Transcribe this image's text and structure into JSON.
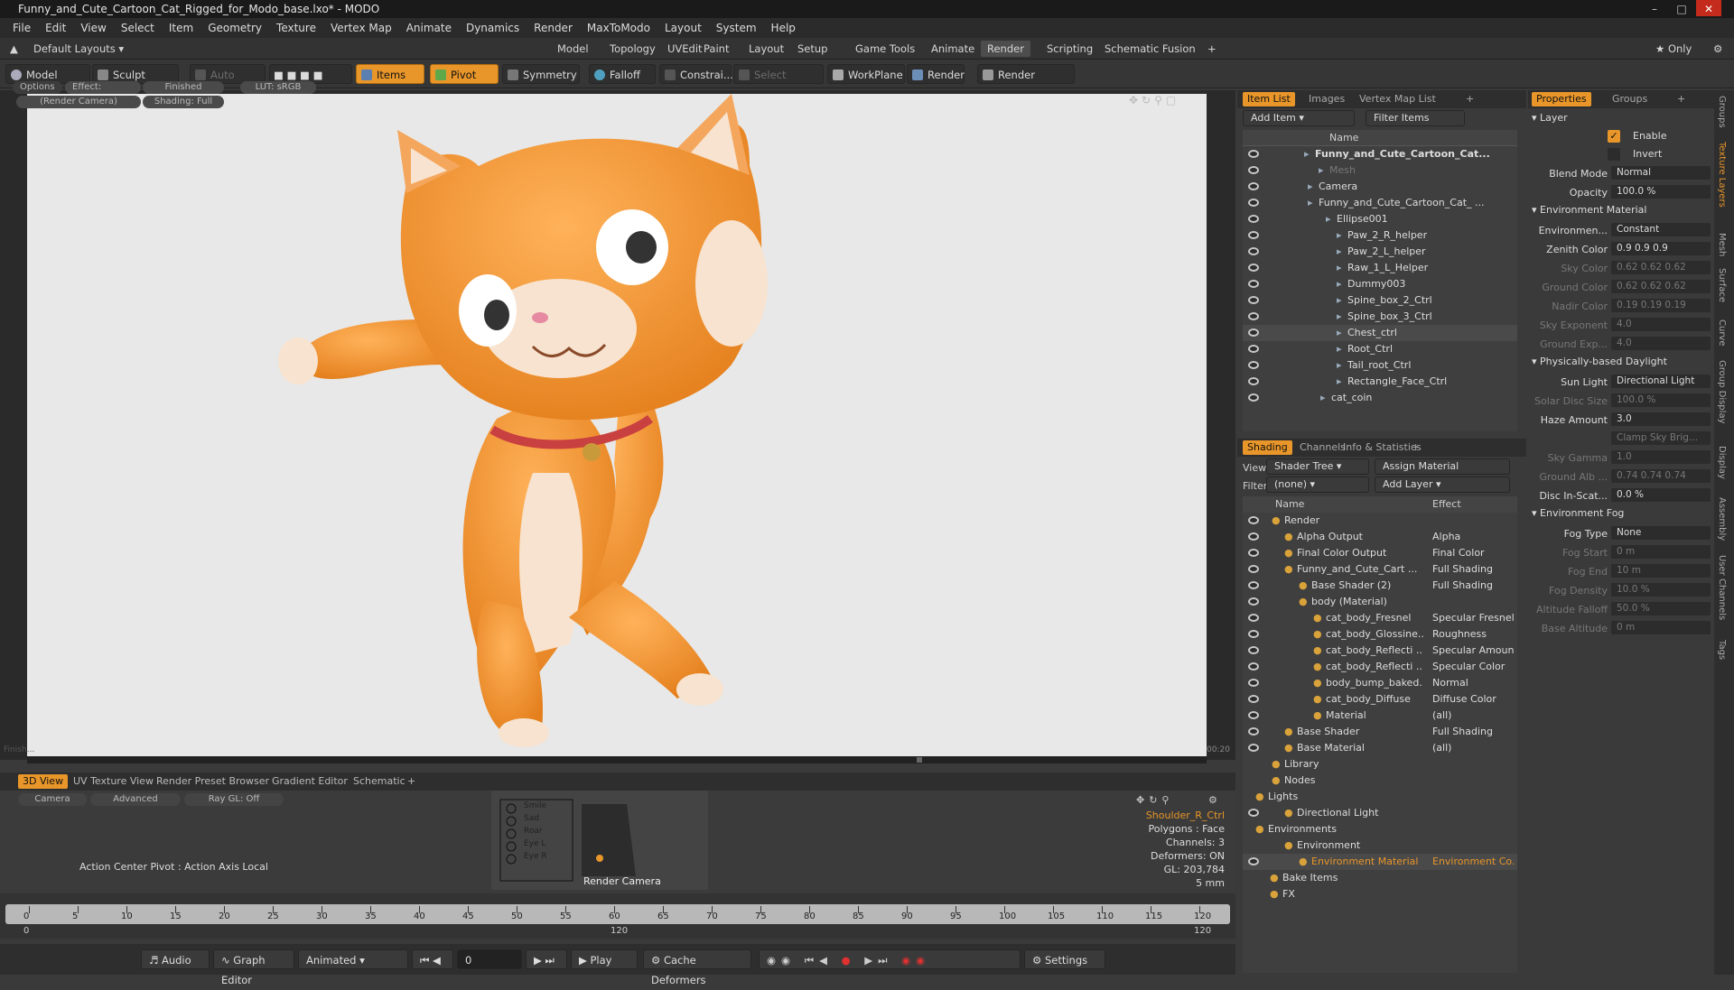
{
  "window": {
    "title": "Funny_and_Cute_Cartoon_Cat_Rigged_for_Modo_base.lxo* - MODO"
  },
  "menu": [
    "File",
    "Edit",
    "View",
    "Select",
    "Item",
    "Geometry",
    "Texture",
    "Vertex Map",
    "Animate",
    "Dynamics",
    "Render",
    "MaxToModo",
    "Layout",
    "System",
    "Help"
  ],
  "layoutbar": {
    "layout": "Default Layouts",
    "tabs": [
      "Model",
      "Topology",
      "UVEdit",
      "Paint",
      "Layout",
      "Setup",
      "Game Tools",
      "Animate",
      "Render",
      "Scripting",
      "Schematic Fusion",
      "+"
    ],
    "only": "Only"
  },
  "toolbar": {
    "model": "Model",
    "sculpt": "Sculpt",
    "auto_select": "Auto Select",
    "items": "Items",
    "pivot": "Pivot",
    "symmetry": "Symmetry",
    "falloff": "Falloff",
    "constrain": "Constrai...",
    "select_through": "Select Through",
    "workplane": "WorkPlane",
    "render": "Render",
    "render_window": "Render Window"
  },
  "viewport": {
    "options": "Options",
    "effect": "Effect: (Shadi...",
    "finished": "Finished",
    "lut": "LUT: sRGB",
    "camera": "(Render Camera)",
    "shading": "Shading: Full",
    "status_left": "Finish...",
    "time": "00:20"
  },
  "bottomtabs": [
    "3D View",
    "UV Texture View",
    "Render Preset Browser",
    "Gradient Editor",
    "Schematic",
    "+"
  ],
  "bottompanel": {
    "camera": "Camera",
    "advanced": "Advanced",
    "raygl": "Ray GL: Off",
    "action": "Action Center Pivot : Action Axis Local",
    "render_camera": "Render Camera",
    "selected": "Shoulder_R_Ctrl",
    "polygons": "Polygons : Face",
    "channels": "Channels: 3",
    "deformers": "Deformers: ON",
    "gl": "GL: 203,784",
    "unit": "5 mm",
    "mini_labels": [
      "Smile",
      "Sad",
      "Roar",
      "Eye L",
      "Eye R"
    ]
  },
  "timeline": {
    "ticks": [
      "0",
      "5",
      "10",
      "15",
      "20",
      "25",
      "30",
      "35",
      "40",
      "45",
      "50",
      "55",
      "60",
      "65",
      "70",
      "75",
      "80",
      "85",
      "90",
      "95",
      "100",
      "105",
      "110",
      "115",
      "120"
    ],
    "start": "0",
    "mid": "120",
    "end": "120"
  },
  "transport": {
    "audio": "Audio",
    "graph": "Graph Editor",
    "animated": "Animated",
    "frame": "0",
    "play": "Play",
    "cache": "Cache Deformers",
    "settings": "Settings"
  },
  "itemlist": {
    "tabs": [
      "Item List",
      "Images",
      "Vertex Map List",
      "+"
    ],
    "add_item": "Add Item",
    "filter": "Filter Items",
    "header": "Name",
    "rows": [
      "Funny_and_Cute_Cartoon_Cat...",
      "Mesh",
      "Camera",
      "Funny_and_Cute_Cartoon_Cat_ ...",
      "Ellipse001",
      "Paw_2_R_helper",
      "Paw_2_L_helper",
      "Raw_1_L_Helper",
      "Dummy003",
      "Spine_box_2_Ctrl",
      "Spine_box_3_Ctrl",
      "Chest_ctrl",
      "Root_Ctrl",
      "Tail_root_Ctrl",
      "Rectangle_Face_Ctrl",
      "cat_coin"
    ]
  },
  "shading": {
    "tabs": [
      "Shading",
      "Channels",
      "Info & Statistics",
      "+"
    ],
    "view_label": "View",
    "view": "Shader Tree",
    "assign": "Assign Material",
    "filter_label": "Filter",
    "filter": "(none)",
    "add_layer": "Add Layer",
    "col_name": "Name",
    "col_effect": "Effect",
    "rows": [
      {
        "n": "Render",
        "e": ""
      },
      {
        "n": "Alpha Output",
        "e": "Alpha"
      },
      {
        "n": "Final Color Output",
        "e": "Final Color"
      },
      {
        "n": "Funny_and_Cute_Cart ...",
        "e": "Full Shading"
      },
      {
        "n": "Base Shader (2)",
        "e": "Full Shading"
      },
      {
        "n": "body (Material)",
        "e": ""
      },
      {
        "n": "cat_body_Fresnel",
        "e": "Specular Fresnel"
      },
      {
        "n": "cat_body_Glossine...",
        "e": "Roughness"
      },
      {
        "n": "cat_body_Reflecti ...",
        "e": "Specular Amount"
      },
      {
        "n": "cat_body_Reflecti ...",
        "e": "Specular Color"
      },
      {
        "n": "body_bump_baked...",
        "e": "Normal"
      },
      {
        "n": "cat_body_Diffuse",
        "e": "Diffuse Color"
      },
      {
        "n": "Material",
        "e": "(all)"
      },
      {
        "n": "Base Shader",
        "e": "Full Shading"
      },
      {
        "n": "Base Material",
        "e": "(all)"
      },
      {
        "n": "Library",
        "e": ""
      },
      {
        "n": "Nodes",
        "e": ""
      },
      {
        "n": "Lights",
        "e": ""
      },
      {
        "n": "Directional Light",
        "e": ""
      },
      {
        "n": "Environments",
        "e": ""
      },
      {
        "n": "Environment",
        "e": ""
      },
      {
        "n": "Environment Material",
        "e": "Environment Co..."
      },
      {
        "n": "Bake Items",
        "e": ""
      },
      {
        "n": "FX",
        "e": ""
      }
    ]
  },
  "properties": {
    "tabs": [
      "Properties",
      "Groups",
      "+"
    ],
    "layer": "Layer",
    "enable": "Enable",
    "invert": "Invert",
    "rows": [
      {
        "l": "Blend Mode",
        "v": "Normal",
        "d": false
      },
      {
        "l": "Opacity",
        "v": "100.0 %",
        "d": false
      },
      {
        "h": "Environment Material"
      },
      {
        "l": "Environmen...",
        "v": "Constant",
        "d": false
      },
      {
        "l": "Zenith Color",
        "v": "0.9   0.9   0.9",
        "d": false
      },
      {
        "l": "Sky Color",
        "v": "0.62  0.62  0.62",
        "d": true
      },
      {
        "l": "Ground Color",
        "v": "0.62  0.62  0.62",
        "d": true
      },
      {
        "l": "Nadir Color",
        "v": "0.19  0.19  0.19",
        "d": true
      },
      {
        "l": "Sky Exponent",
        "v": "4.0",
        "d": true
      },
      {
        "l": "Ground Exp...",
        "v": "4.0",
        "d": true
      },
      {
        "h": "Physically-based Daylight"
      },
      {
        "l": "Sun Light",
        "v": "Directional Light",
        "d": false
      },
      {
        "l": "Solar Disc Size",
        "v": "100.0 %",
        "d": true
      },
      {
        "l": "Haze Amount",
        "v": "3.0",
        "d": false
      },
      {
        "l": "",
        "v": "Clamp Sky Brig...",
        "d": true
      },
      {
        "l": "Sky Gamma",
        "v": "1.0",
        "d": true
      },
      {
        "l": "Ground Alb ...",
        "v": "0.74  0.74  0.74",
        "d": true
      },
      {
        "l": "Disc In-Scat...",
        "v": "0.0 %",
        "d": false
      },
      {
        "h": "Environment Fog"
      },
      {
        "l": "Fog Type",
        "v": "None",
        "d": false
      },
      {
        "l": "Fog Start",
        "v": "0 m",
        "d": true
      },
      {
        "l": "Fog End",
        "v": "10 m",
        "d": true
      },
      {
        "l": "Fog Density",
        "v": "10.0 %",
        "d": true
      },
      {
        "l": "Altitude Falloff",
        "v": "50.0 %",
        "d": true
      },
      {
        "l": "Base Altitude",
        "v": "0 m",
        "d": true
      }
    ]
  },
  "sidetabs": [
    "Groups",
    "Texture Layers",
    "Mesh",
    "Surface",
    "Curve",
    "Group Display",
    "Display",
    "Assembly",
    "User Channels",
    "Tags"
  ],
  "colors": {
    "accent": "#e8962a",
    "panel": "#3a3a3a",
    "cat_orange": "#f2942e",
    "cat_cream": "#f7e3cf"
  }
}
